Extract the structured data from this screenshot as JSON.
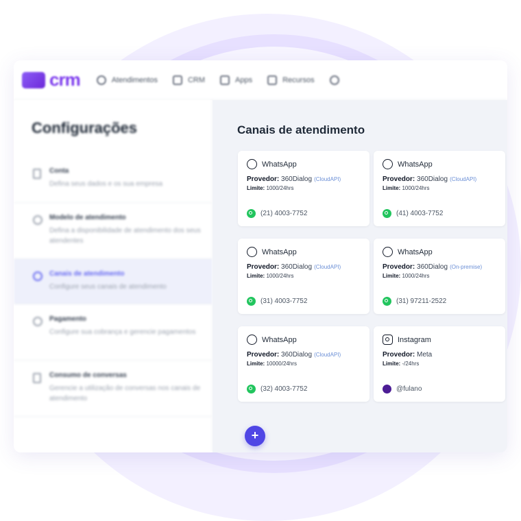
{
  "header": {
    "logo_text": "crm",
    "nav": [
      {
        "label": "Atendimentos",
        "icon": "chat-icon"
      },
      {
        "label": "CRM",
        "icon": "network-icon"
      },
      {
        "label": "Apps",
        "icon": "apps-icon"
      },
      {
        "label": "Recursos",
        "icon": "resources-icon"
      },
      {
        "label": "",
        "icon": "settings-icon"
      }
    ]
  },
  "sidebar": {
    "title": "Configurações",
    "items": [
      {
        "title": "Conta",
        "desc": "Defina seus dados e os sua empresa",
        "icon": "document-icon",
        "active": false
      },
      {
        "title": "Modelo de atendimento",
        "desc": "Defina a disponibilidade de atendimento dos seus atendentes",
        "icon": "clock-icon",
        "active": false
      },
      {
        "title": "Canais de atendimento",
        "desc": "Configure seus canais de atendimento",
        "icon": "chat-icon",
        "active": true
      },
      {
        "title": "Pagamento",
        "desc": "Configure sua cobrança e gerencie pagamentos",
        "icon": "payment-icon",
        "active": false
      },
      {
        "title": "Consumo de conversas",
        "desc": "Gerencie a utilização de conversas nos canais de atendimento",
        "icon": "document-icon",
        "active": false
      }
    ]
  },
  "main": {
    "title": "Canais de atendimento",
    "provider_label": "Provedor:",
    "limit_label": "Limite:",
    "cards": [
      {
        "channel": "WhatsApp",
        "provider": "360Dialog",
        "api": "(CloudAPI)",
        "limit": "1000/24hrs",
        "contact": "(21) 4003-7752",
        "kind": "whatsapp"
      },
      {
        "channel": "WhatsApp",
        "provider": "360Dialog",
        "api": "(CloudAPI)",
        "limit": "1000/24hrs",
        "contact": "(41) 4003-7752",
        "kind": "whatsapp"
      },
      {
        "channel": "WhatsApp",
        "provider": "360Dialog",
        "api": "(CloudAPI)",
        "limit": "1000/24hrs",
        "contact": "(31) 4003-7752",
        "kind": "whatsapp"
      },
      {
        "channel": "WhatsApp",
        "provider": "360Dialog",
        "api": "(On-premise)",
        "limit": "1000/24hrs",
        "contact": "(31) 97211-2522",
        "kind": "whatsapp"
      },
      {
        "channel": "WhatsApp",
        "provider": "360Dialog",
        "api": "(CloudAPI)",
        "limit": "10000/24hrs",
        "contact": "(32) 4003-7752",
        "kind": "whatsapp"
      },
      {
        "channel": "Instagram",
        "provider": "Meta",
        "api": "",
        "limit": "-/24hrs",
        "contact": "@fulano",
        "kind": "instagram"
      }
    ],
    "fab_label": "+"
  }
}
